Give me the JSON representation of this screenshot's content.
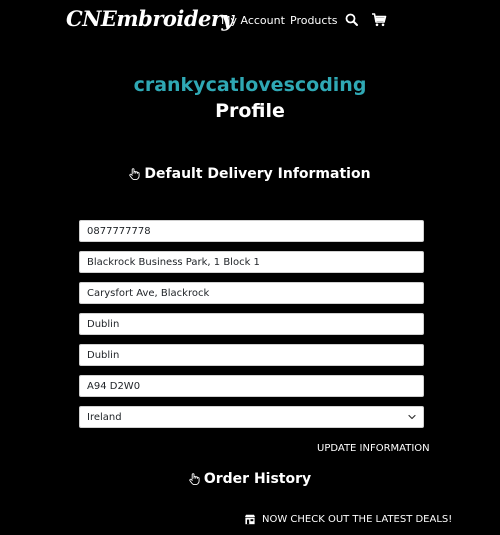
{
  "header": {
    "brand": "CNEmbroidery",
    "nav": {
      "account": "My Account",
      "products": "Products",
      "search_icon": "search-icon",
      "cart_icon": "cart-icon"
    }
  },
  "profile": {
    "username": "crankycatlovescoding",
    "title": "Profile"
  },
  "delivery": {
    "heading": "Default Delivery Information",
    "heading_icon": "hand-pointer-icon",
    "fields": {
      "phone": "0877777778",
      "street1": "Blackrock Business Park, 1 Block 1",
      "street2": "Carysfort Ave, Blackrock",
      "town": "Dublin",
      "county": "Dublin",
      "postcode": "A94 D2W0",
      "country": "Ireland"
    },
    "update_label": "UPDATE INFORMATION"
  },
  "orders": {
    "heading": "Order History",
    "heading_icon": "hand-pointer-icon"
  },
  "banner": {
    "text": "NOW CHECK OUT THE LATEST DEALS!",
    "icon": "shop-icon"
  },
  "colors": {
    "background": "#000000",
    "accent": "#2fa8b4",
    "text": "#ffffff"
  }
}
